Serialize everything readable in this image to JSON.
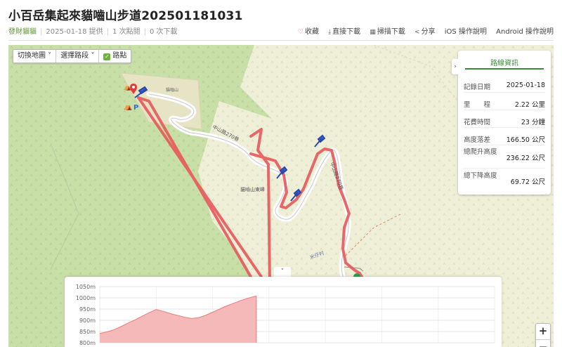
{
  "title": "小百岳集起來貓嚙山步道202501181031",
  "meta": {
    "author": "發財貓貓",
    "provided": "2025-01-18 提供",
    "clicks": "1 次點閱",
    "downloads": "0 次下載"
  },
  "actions": {
    "favorite": "收藏",
    "download": "直接下載",
    "scan": "掃描下載",
    "share": "分享",
    "ios": "iOS 操作說明",
    "android": "Android 操作說明"
  },
  "map_toolbar": {
    "switch_map": "切換地圖",
    "select_segment": "選擇路段",
    "waypoints": "路點"
  },
  "route_info": {
    "title": "路線資訊",
    "toggle": "›",
    "rows": [
      {
        "label": "記錄日期",
        "value": "2025-01-18"
      },
      {
        "label": "里　　程",
        "value": "2.22 公里"
      },
      {
        "label": "花費時間",
        "value": "23 分鐘"
      },
      {
        "label": "高度落差",
        "value": "166.50 公尺"
      },
      {
        "label": "總爬升高度",
        "value": "236.22 公尺"
      },
      {
        "label": "總下降高度",
        "value": "69.72 公尺"
      }
    ]
  },
  "map_labels": {
    "road": "中山路270巷",
    "road2": "中山路270巷",
    "landmark": "貓嚙山東峰",
    "mountain_label": "貓嚙山",
    "village": "米仔村"
  },
  "elevation": {
    "collapse": "˅",
    "ticks": [
      "1050m",
      "1000m",
      "950m",
      "900m",
      "850m",
      "800m"
    ]
  },
  "zoom": {
    "in": "+",
    "out": "−"
  },
  "chart_data": {
    "type": "area",
    "ylabel": "",
    "ylim": [
      800,
      1050
    ],
    "x": [
      0,
      0.1,
      0.2,
      0.3,
      0.4,
      0.5,
      0.6,
      0.7,
      0.8,
      0.9,
      1.0,
      1.1,
      1.2,
      1.3,
      1.4,
      1.5,
      1.6,
      1.7,
      1.8,
      1.9,
      2.0,
      2.1,
      2.22
    ],
    "values": [
      842,
      848,
      858,
      872,
      888,
      902,
      918,
      934,
      948,
      940,
      930,
      922,
      914,
      908,
      912,
      922,
      936,
      950,
      964,
      976,
      988,
      998,
      1008
    ]
  }
}
